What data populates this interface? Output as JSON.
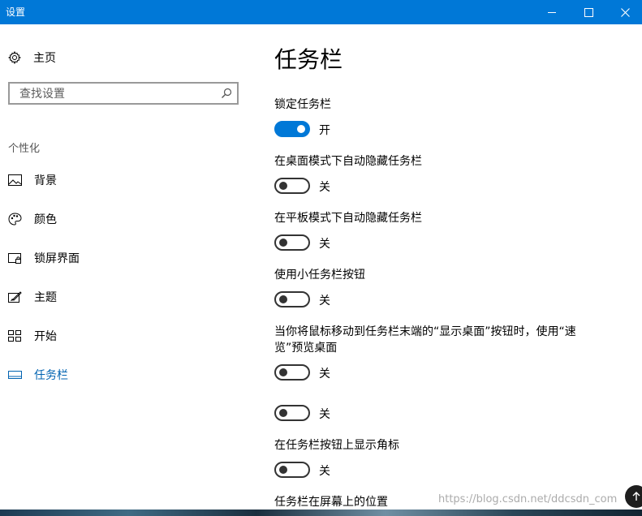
{
  "window": {
    "title": "设置"
  },
  "sidebar": {
    "home_label": "主页",
    "search_placeholder": "查找设置",
    "section_label": "个性化",
    "items": [
      {
        "label": "背景",
        "icon": "picture-icon"
      },
      {
        "label": "颜色",
        "icon": "palette-icon"
      },
      {
        "label": "锁屏界面",
        "icon": "lock-screen-icon"
      },
      {
        "label": "主题",
        "icon": "theme-icon"
      },
      {
        "label": "开始",
        "icon": "start-icon"
      },
      {
        "label": "任务栏",
        "icon": "taskbar-icon",
        "active": true
      }
    ]
  },
  "main": {
    "title": "任务栏",
    "settings": [
      {
        "label": "锁定任务栏",
        "state": "开",
        "on": true
      },
      {
        "label": "在桌面模式下自动隐藏任务栏",
        "state": "关",
        "on": false
      },
      {
        "label": "在平板模式下自动隐藏任务栏",
        "state": "关",
        "on": false
      },
      {
        "label": "使用小任务栏按钮",
        "state": "关",
        "on": false
      },
      {
        "label": "当你将鼠标移动到任务栏末端的“显示桌面”按钮时，使用“速览”预览桌面",
        "state": "关",
        "on": false
      },
      {
        "label": "",
        "state": "关",
        "on": false
      },
      {
        "label": "在任务栏按钮上显示角标",
        "state": "关",
        "on": false
      }
    ],
    "next_section_label": "任务栏在屏幕上的位置"
  },
  "watermark": "https://blog.csdn.net/ddcsdn_com",
  "colors": {
    "accent": "#0078d7",
    "active_nav": "#0063b1"
  }
}
